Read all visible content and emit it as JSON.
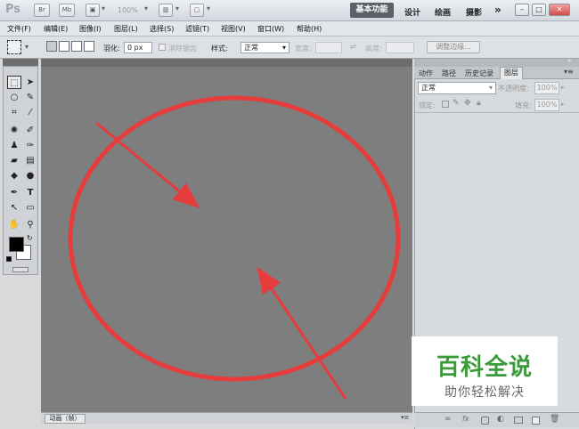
{
  "titlebar": {
    "logo": "Ps",
    "bridge_label": "Br",
    "minibridge_label": "Mb",
    "zoom_value": "100%",
    "workspaces": [
      "基本功能",
      "设计",
      "绘画",
      "摄影"
    ],
    "more_label": "»",
    "window_controls": {
      "minimize": "–",
      "restore": "□",
      "close": "✕"
    }
  },
  "menubar": {
    "items": [
      "文件(F)",
      "编辑(E)",
      "图像(I)",
      "图层(L)",
      "选择(S)",
      "滤镜(T)",
      "视图(V)",
      "窗口(W)",
      "帮助(H)"
    ]
  },
  "options": {
    "feather_label": "羽化:",
    "feather_value": "0 px",
    "antialias_label": "消除锯齿",
    "style_label": "样式:",
    "style_value": "正常",
    "width_label": "宽度:",
    "height_label": "高度:",
    "refine_edge_label": "调整边缘..."
  },
  "right_panel": {
    "tabs": [
      "动作",
      "路径",
      "历史记录",
      "图层"
    ],
    "active_tab": "图层",
    "blend_mode": "正常",
    "opacity_label": "不透明度:",
    "opacity_value": "100%",
    "lock_label": "锁定:",
    "fill_label": "填充:",
    "fill_value": "100%"
  },
  "bottom_bar": {
    "tab_label": "动画（帧）"
  },
  "watermark": {
    "title": "百科全说",
    "subtitle": "助你轻松解决"
  },
  "colors": {
    "annotation_red": "#e63c3c",
    "canvas_gray": "#7e7e7e",
    "watermark_green": "#3b9b3b"
  }
}
